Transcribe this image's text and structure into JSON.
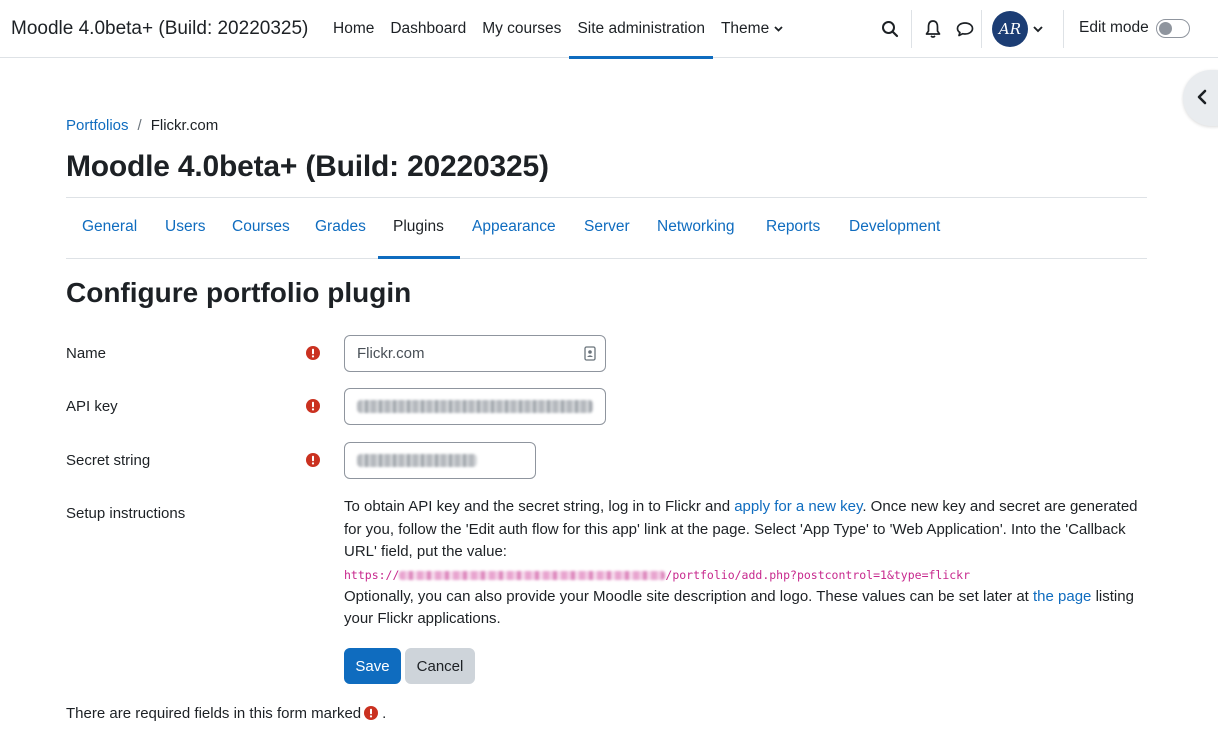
{
  "navbar": {
    "site_name": "Moodle 4.0beta+ (Build: 20220325)",
    "links": [
      "Home",
      "Dashboard",
      "My courses",
      "Site administration",
      "Theme"
    ],
    "active_link": "Site administration",
    "user_initials": "AR",
    "edit_mode_label": "Edit mode",
    "edit_mode_on": false
  },
  "breadcrumb": {
    "items": [
      "Portfolios",
      "Flickr.com"
    ],
    "separator": "/"
  },
  "page": {
    "title": "Moodle 4.0beta+ (Build: 20220325)"
  },
  "tabs": {
    "items": [
      "General",
      "Users",
      "Courses",
      "Grades",
      "Plugins",
      "Appearance",
      "Server",
      "Networking",
      "Reports",
      "Development"
    ],
    "active": "Plugins"
  },
  "form": {
    "heading": "Configure portfolio plugin",
    "fields": {
      "name": {
        "label": "Name",
        "value": "Flickr.com",
        "required": true
      },
      "api_key": {
        "label": "API key",
        "value_redacted": true,
        "required": true
      },
      "secret": {
        "label": "Secret string",
        "value_redacted": true,
        "required": true
      }
    },
    "setup": {
      "label": "Setup instructions",
      "text_1": "To obtain API key and the secret string, log in to Flickr and ",
      "link_1": "apply for a new key",
      "text_2": ". Once new key and secret are generated for you, follow the 'Edit auth flow for this app' link at the page. Select 'App Type' to 'Web Application'. Into the 'Callback URL' field, put the value:",
      "callback_url_prefix": "https://",
      "callback_url_suffix": "/portfolio/add.php?postcontrol=1&type=flickr",
      "text_3": "Optionally, you can also provide your Moodle site description and logo. These values can be set later at ",
      "link_2": "the page",
      "text_4": " listing your Flickr applications."
    },
    "buttons": {
      "save": "Save",
      "cancel": "Cancel"
    },
    "required_note_prefix": "There are required fields in this form marked",
    "required_note_suffix": "."
  },
  "colors": {
    "accent": "#0f6cbf",
    "required": "#ca3120",
    "code": "#c7288d"
  }
}
